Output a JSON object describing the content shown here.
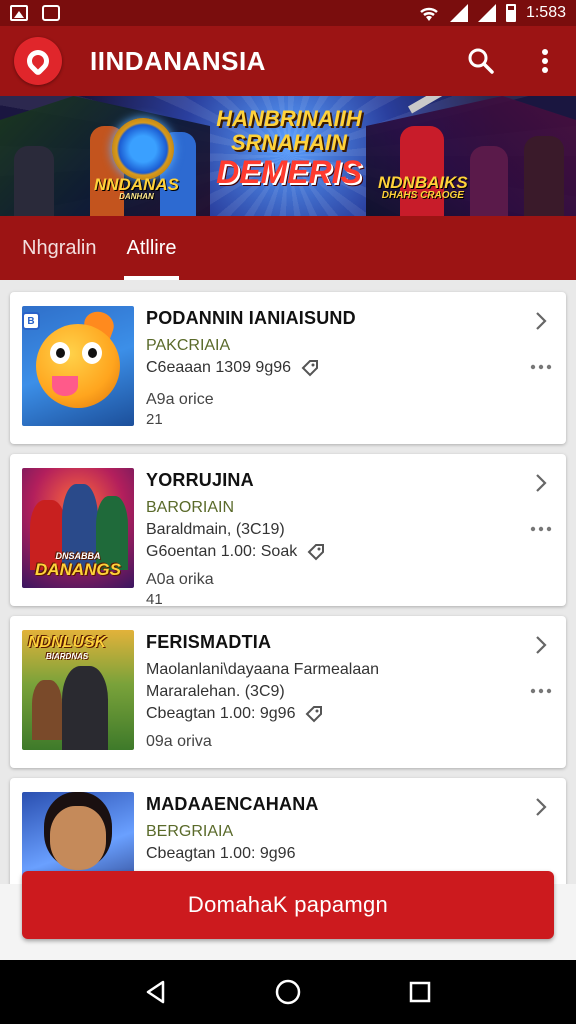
{
  "status_bar": {
    "time": "1:583"
  },
  "app_bar": {
    "title": "IINDANANSIA"
  },
  "banner": {
    "headline_1": "HANBRINAIIH",
    "headline_2": "SRNAHAIN",
    "headline_3": "DEMERIS",
    "left_logo": "NNDANAS",
    "left_logo_sub": "DANHAN",
    "right_logo": "NDNBAIKS",
    "right_logo_sub": "DHAHS CRAOGE"
  },
  "tabs": [
    {
      "label": "Nhgralin",
      "active": false
    },
    {
      "label": "Atllire",
      "active": true
    }
  ],
  "cards": [
    {
      "title": "PODANNIN IANIAISUND",
      "subtitle": "PAKCRIAIA",
      "line": "C6eaaan 1309 9g96",
      "offer": "A9a orice",
      "rank": "21",
      "badge": "B"
    },
    {
      "title": "YORRUJINA",
      "subtitle": "BARORIAIN",
      "line_extra": "Baraldmain, (3C19)",
      "line": "G6oentan 1.00: Soak",
      "offer": "A0a orika",
      "rank": "41",
      "thumb_label": "DANANGS",
      "thumb_label_small": "DNSABBA"
    },
    {
      "title": "FERISMADTIA",
      "subtitle": "Maolanlani\\dayaana Farmealaan",
      "line_extra": "Mararalehan. (3C9)",
      "line": "Cbeagtan 1.00: 9g96",
      "offer": "09a oriva",
      "thumb_label": "NDNLUSK",
      "thumb_label_small": "BIARDNAS"
    },
    {
      "title": "MADAAENCAHANA",
      "subtitle": "BERGRIAIA",
      "line": "Cbeagtan 1.00: 9g96"
    }
  ],
  "cta": {
    "label": "DomahaK papamgn"
  },
  "colors": {
    "primary": "#9c1414",
    "status": "#7a0d0d",
    "cta": "#cc1a1e",
    "accent_text": "#5a6a2a"
  }
}
